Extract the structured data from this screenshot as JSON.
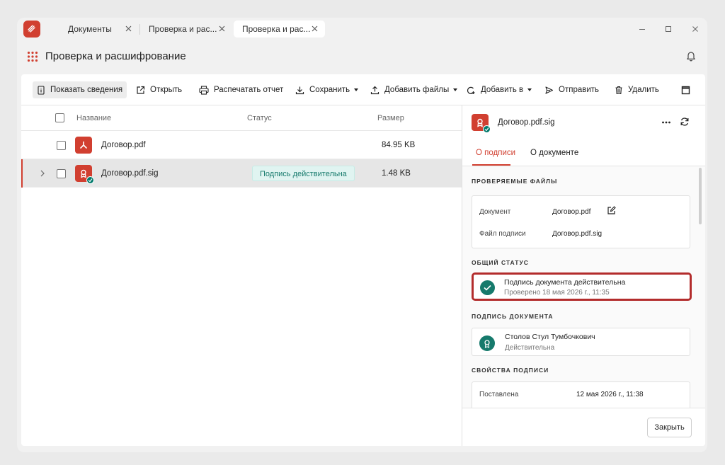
{
  "tabs": [
    {
      "label": "Документы"
    },
    {
      "label": "Проверка и рас..."
    },
    {
      "label": "Проверка и рас..."
    }
  ],
  "header": {
    "title": "Проверка и расшифрование"
  },
  "toolbar": {
    "show_details": "Показать сведения",
    "open": "Открыть",
    "print_report": "Распечатать отчет",
    "save": "Сохранить",
    "add_files": "Добавить файлы",
    "add_to": "Добавить в",
    "send": "Отправить",
    "delete": "Удалить"
  },
  "list": {
    "columns": {
      "name": "Название",
      "status": "Статус",
      "size": "Размер"
    },
    "rows": [
      {
        "name": "Договор.pdf",
        "status": "",
        "size": "84.95 KB",
        "selected": false
      },
      {
        "name": "Договор.pdf.sig",
        "status": "Подпись действительна",
        "size": "1.48 KB",
        "selected": true
      }
    ]
  },
  "panel": {
    "title": "Договор.pdf.sig",
    "tabs": {
      "signature": "О подписи",
      "document": "О документе"
    },
    "checked_files": {
      "title": "ПРОВЕРЯЕМЫЕ ФАЙЛЫ",
      "document_label": "Документ",
      "document_value": "Договор.pdf",
      "signature_file_label": "Файл подписи",
      "signature_file_value": "Договор.pdf.sig"
    },
    "overall": {
      "title": "ОБЩИЙ СТАТУС",
      "status": "Подпись документа действительна",
      "checked": "Проверено 18 мая 2026 г., 11:35"
    },
    "doc_signature": {
      "title": "ПОДПИСЬ ДОКУМЕНТА",
      "signer": "Столов Стул Тумбочкович",
      "state": "Действительна"
    },
    "signature_props": {
      "title": "СВОЙСТВА ПОДПИСИ",
      "placed_label": "Поставлена",
      "placed_value": "12 мая 2026 г., 11:38"
    },
    "close": "Закрыть"
  },
  "colors": {
    "accent": "#d13f30",
    "ok": "#167a6c",
    "highlight": "#b32c2c"
  }
}
